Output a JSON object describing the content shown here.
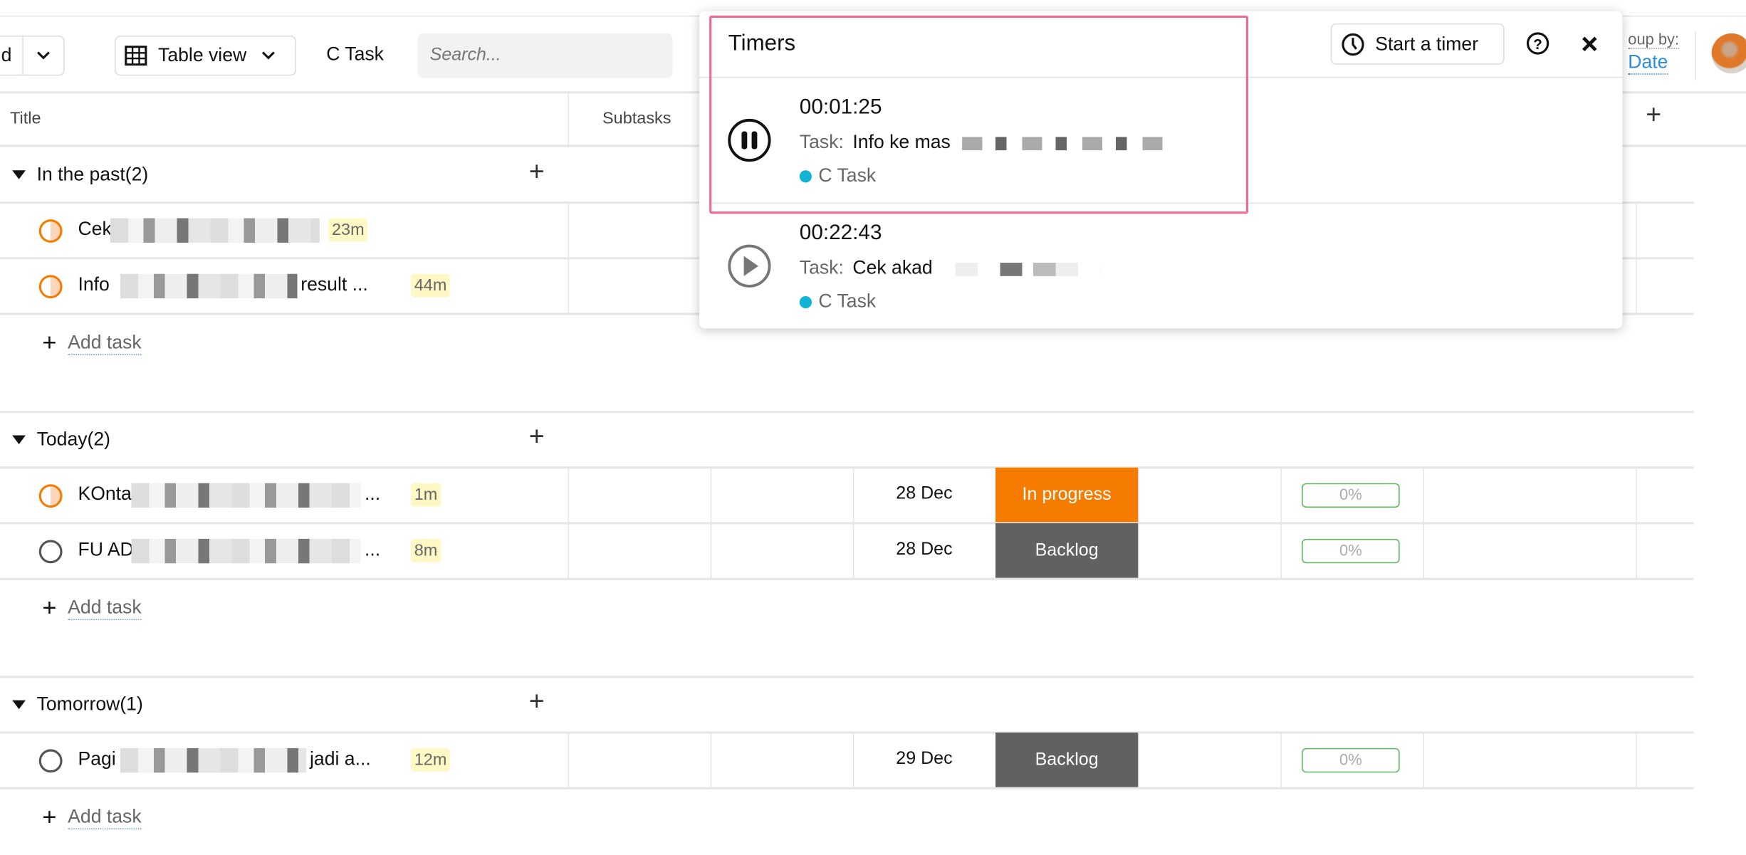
{
  "toolbar": {
    "partial_button_label": "d",
    "view_label": "Table view",
    "project_label": "C Task",
    "search_placeholder": "Search...",
    "group_by_label": "oup by:",
    "group_by_value": "Date"
  },
  "table": {
    "columns": [
      "Title",
      "Subtasks"
    ],
    "add_task_label": "Add task",
    "groups": [
      {
        "label": "In the past(2)",
        "rows": [
          {
            "prefix": "Cek",
            "suffix": "",
            "time": "23m",
            "status_type": "in-progress",
            "date": "",
            "status": "",
            "progress": ""
          },
          {
            "prefix": "Info",
            "suffix": "result ...",
            "time": "44m",
            "status_type": "in-progress",
            "date": "",
            "status": "",
            "progress": ""
          }
        ]
      },
      {
        "label": "Today(2)",
        "rows": [
          {
            "prefix": "KOnta",
            "suffix": "...",
            "time": "1m",
            "status_type": "in-progress",
            "date": "28 Dec",
            "status": "In progress",
            "progress": "0%"
          },
          {
            "prefix": "FU AD",
            "suffix": "...",
            "time": "8m",
            "status_type": "todo",
            "date": "28 Dec",
            "status": "Backlog",
            "progress": "0%"
          }
        ]
      },
      {
        "label": "Tomorrow(1)",
        "rows": [
          {
            "prefix": "Pagi",
            "suffix": "jadi a...",
            "time": "12m",
            "status_type": "todo",
            "date": "29 Dec",
            "status": "Backlog",
            "progress": "0%"
          }
        ]
      }
    ]
  },
  "colors": {
    "in_progress": "#f57c00",
    "backlog": "#616161",
    "highlight": "#ef6a96",
    "project_dot": "#11b5d3",
    "progress_border": "#5cb85c"
  },
  "timers": {
    "title": "Timers",
    "start_label": "Start a timer",
    "task_label": "Task:",
    "items": [
      {
        "elapsed": "00:01:25",
        "task": "Info ke mas",
        "project": "C Task",
        "state": "running"
      },
      {
        "elapsed": "00:22:43",
        "task": "Cek akad",
        "project": "C Task",
        "state": "paused"
      }
    ]
  }
}
